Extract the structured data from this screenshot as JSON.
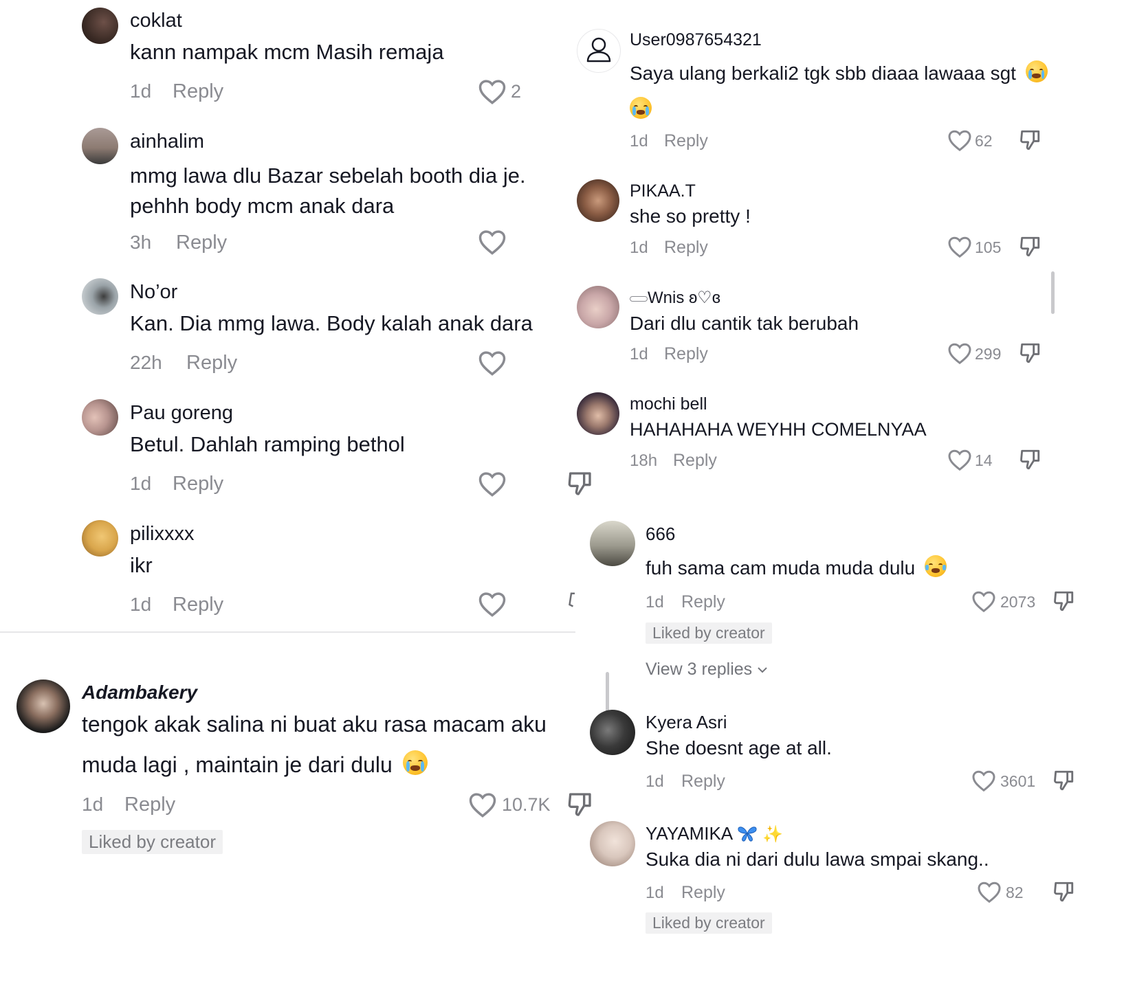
{
  "left": {
    "comments": [
      {
        "user": "coklat",
        "text": "kann nampak mcm Masih remaja",
        "time": "1d",
        "reply": "Reply",
        "likes": "2",
        "avatar_color": "#3b2b25"
      },
      {
        "user": "ainhalim",
        "text": "mmg lawa dlu Bazar sebelah booth dia je. pehhh body mcm anak dara",
        "time": "3h",
        "reply": "Reply",
        "likes": "",
        "avatar_color": "#8d7b72"
      },
      {
        "user": "No’or",
        "text": "Kan. Dia mmg lawa. Body kalah anak dara",
        "time": "22h",
        "reply": "Reply",
        "likes": "",
        "avatar_color": "#c9cfd3"
      },
      {
        "user": "Pau goreng",
        "text": "Betul. Dahlah ramping bethol",
        "time": "1d",
        "reply": "Reply",
        "likes": "",
        "avatar_color": "#b7948f"
      },
      {
        "user": "pilixxxx",
        "text": "ikr",
        "time": "1d",
        "reply": "Reply",
        "likes": "",
        "avatar_color": "#d9a64c"
      }
    ],
    "featured": {
      "user": "Adambakery",
      "text_line1": "tengok akak salina ni buat aku rasa macam aku",
      "text_line2": "muda lagi , maintain je dari dulu",
      "time": "1d",
      "reply": "Reply",
      "likes": "10.7K",
      "liked_by_creator": "Liked by creator",
      "avatar_color": "#1c1c1c"
    }
  },
  "right": {
    "comments": [
      {
        "user": "User0987654321",
        "text": "Saya ulang berkali2 tgk sbb diaaa lawaaa sgt",
        "time": "1d",
        "reply": "Reply",
        "likes": "62"
      },
      {
        "user": "PIKAA.T",
        "text": "she so pretty !",
        "time": "1d",
        "reply": "Reply",
        "likes": "105",
        "avatar_color": "#5a3a2c"
      },
      {
        "user": "Wnis ʚ♡ɞ",
        "text": "Dari dlu cantik tak berubah",
        "time": "1d",
        "reply": "Reply",
        "likes": "299",
        "avatar_color": "#c9a7a8"
      },
      {
        "user": "mochi bell",
        "text": "HAHAHAHA WEYHH COMELNYAA",
        "time": "18h",
        "reply": "Reply",
        "likes": "14",
        "avatar_color": "#5c4a5c"
      }
    ],
    "threaded": [
      {
        "user": "666",
        "text": "fuh sama cam muda muda dulu",
        "time": "1d",
        "reply": "Reply",
        "likes": "2073",
        "liked_by_creator": "Liked by creator",
        "view_replies": "View 3 replies",
        "avatar_color": "#9c9a8e"
      },
      {
        "user": "Kyera Asri",
        "text": "She doesnt age at all.",
        "time": "1d",
        "reply": "Reply",
        "likes": "3601",
        "avatar_color": "#3a3a3a"
      },
      {
        "user": "YAYAMIKA",
        "text": "Suka dia ni dari dulu lawa smpai skang..",
        "time": "1d",
        "reply": "Reply",
        "likes": "82",
        "liked_by_creator": "Liked by creator",
        "avatar_color": "#d9c7bd"
      }
    ]
  },
  "colors": {
    "text": "#161823",
    "muted": "#8a8b91",
    "badge_bg": "#f1f1f2"
  }
}
